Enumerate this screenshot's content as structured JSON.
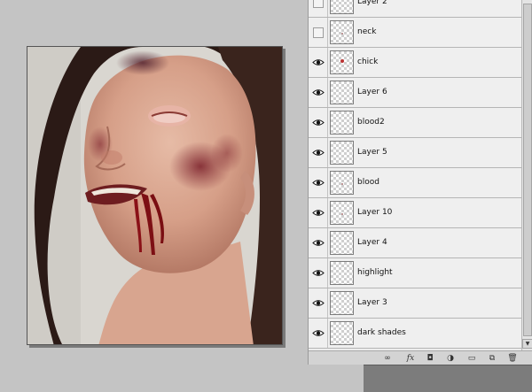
{
  "layers": [
    {
      "name": "Layer 2",
      "visible": false,
      "mark": "none"
    },
    {
      "name": "neck",
      "visible": false,
      "mark": "tiny"
    },
    {
      "name": "chick",
      "visible": true,
      "mark": "dot"
    },
    {
      "name": "Layer 6",
      "visible": true,
      "mark": "none"
    },
    {
      "name": "blood2",
      "visible": true,
      "mark": "none"
    },
    {
      "name": "Layer 5",
      "visible": true,
      "mark": "none"
    },
    {
      "name": "blood",
      "visible": true,
      "mark": "tiny"
    },
    {
      "name": "Layer 10",
      "visible": true,
      "mark": "tiny"
    },
    {
      "name": "Layer 4",
      "visible": true,
      "mark": "none"
    },
    {
      "name": "highlight",
      "visible": true,
      "mark": "none"
    },
    {
      "name": "Layer 3",
      "visible": true,
      "mark": "none"
    },
    {
      "name": "dark shades",
      "visible": true,
      "mark": "none"
    }
  ],
  "footer_icons": [
    "link-icon",
    "fx-icon",
    "mask-icon",
    "adjustment-icon",
    "folder-icon",
    "new-layer-icon",
    "trash-icon"
  ],
  "footer_glyphs": {
    "link": "∞",
    "fx": "fx",
    "mask": "◘",
    "adjustment": "◑",
    "folder": "▭",
    "new_layer": "⧉",
    "trash": "🗑"
  }
}
